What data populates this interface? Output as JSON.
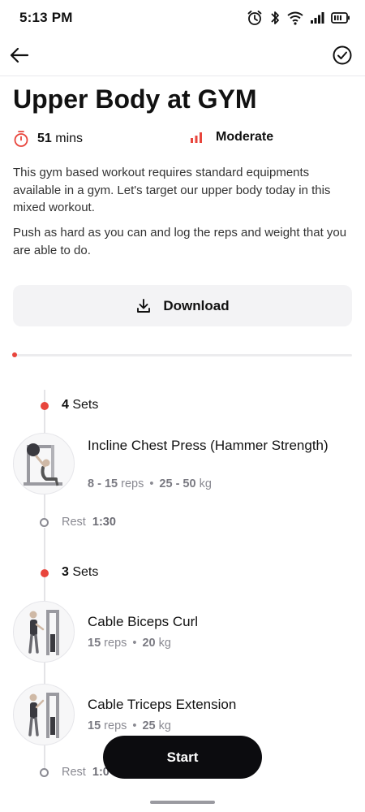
{
  "status": {
    "time": "5:13 PM"
  },
  "workout": {
    "title": "Upper Body at GYM",
    "duration_value": "51",
    "duration_unit": "mins",
    "level": "Moderate",
    "description_1": "This gym based workout requires standard equipments available in a gym. Let's target our upper body today in this mixed workout.",
    "description_2": "Push as hard as you can and log the reps and weight that you are able to do.",
    "download_label": "Download",
    "progress_fraction": 0.0
  },
  "sections": [
    {
      "sets_count": "4",
      "sets_word": "Sets",
      "exercises": [
        {
          "name": "Incline Chest Press (Hammer Strength)",
          "reps": "8 - 15",
          "reps_unit": "reps",
          "weight": "25 - 50",
          "weight_unit": "kg"
        }
      ],
      "rest_label": "Rest",
      "rest_value": "1:30"
    },
    {
      "sets_count": "3",
      "sets_word": "Sets",
      "exercises": [
        {
          "name": "Cable Biceps Curl",
          "reps": "15",
          "reps_unit": "reps",
          "weight": "20",
          "weight_unit": "kg"
        },
        {
          "name": "Cable Triceps Extension",
          "reps": "15",
          "reps_unit": "reps",
          "weight": "25",
          "weight_unit": "kg"
        }
      ],
      "rest_label": "Rest",
      "rest_value": "1:0"
    }
  ],
  "start_label": "Start",
  "colors": {
    "accent": "#e8453c",
    "button_dark": "#0c0c0f",
    "muted": "#8a8a92"
  },
  "icons": [
    "back-arrow-icon",
    "check-circle-icon",
    "stopwatch-icon",
    "signal-bars-icon",
    "download-icon",
    "alarm-icon",
    "bluetooth-icon",
    "wifi-icon",
    "cell-signal-icon",
    "battery-icon"
  ]
}
